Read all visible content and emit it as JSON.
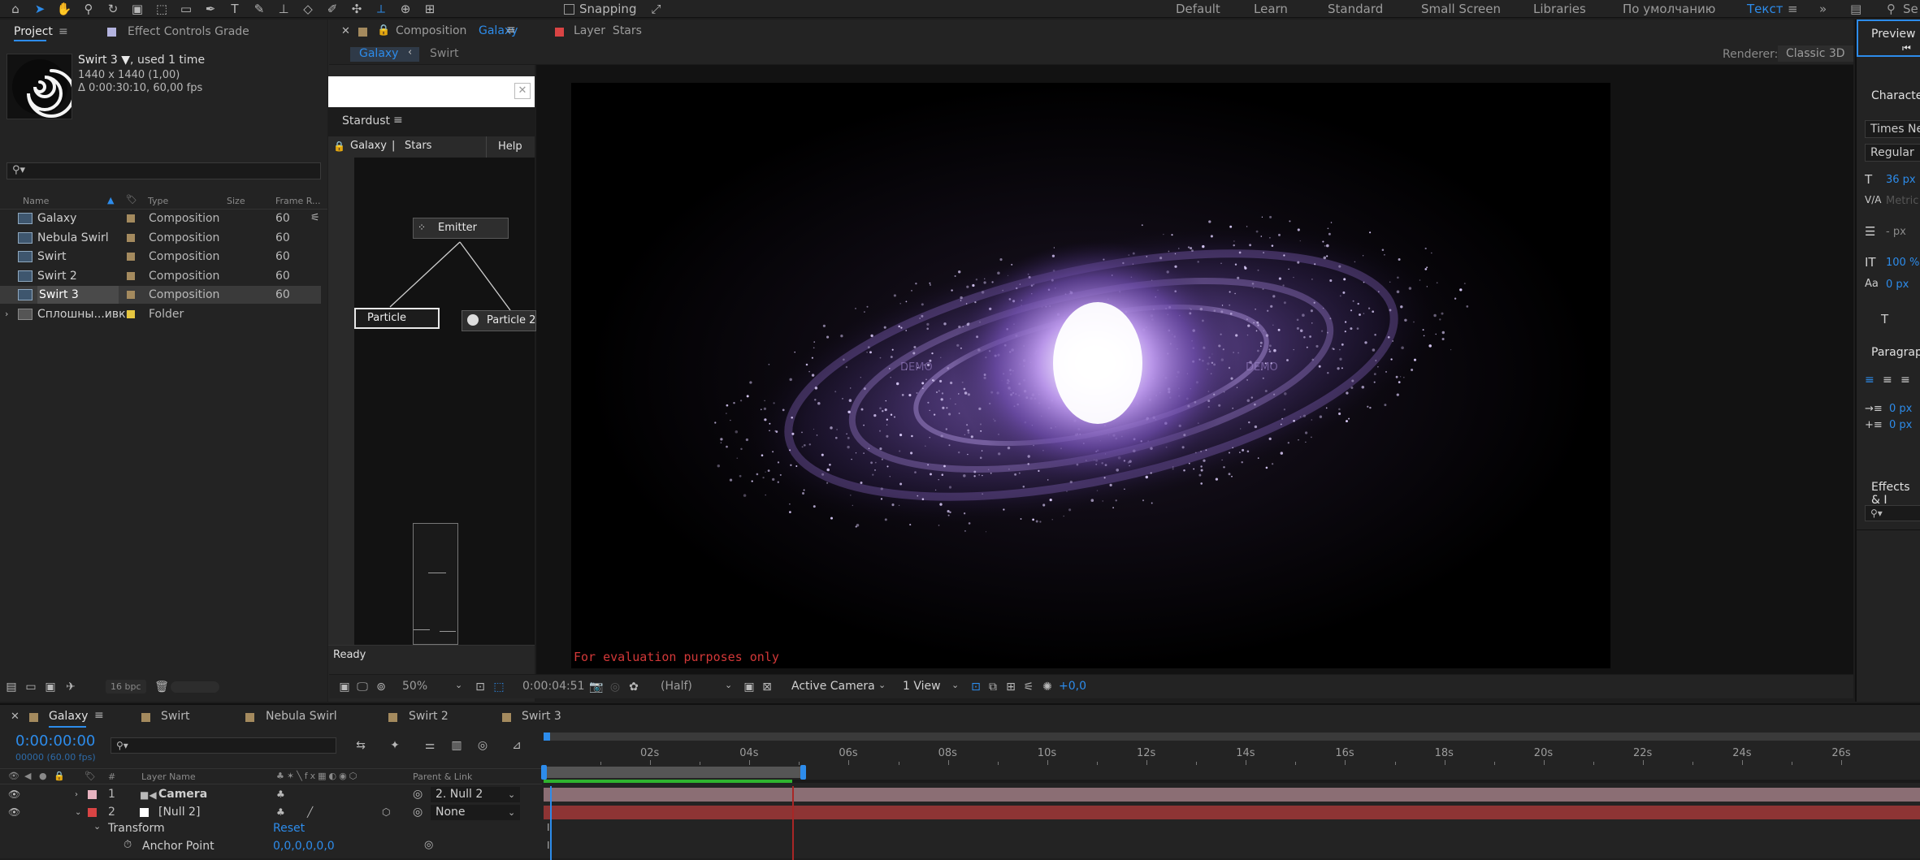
{
  "topbar": {
    "workspaces": [
      "Default",
      "Learn",
      "Standard",
      "Small Screen",
      "Libraries",
      "По умолчанию",
      "Текст"
    ],
    "snapping_label": "Snapping",
    "search_placeholder": "Se"
  },
  "project_panel": {
    "tab_project": "Project",
    "tab_effect_controls": "Effect Controls Grade",
    "selected_name": "Swirt 3 ▼",
    "used_times": ", used 1 time",
    "dimensions": "1440 x 1440 (1,00)",
    "duration": "Δ 0:00:30:10, 60,00 fps",
    "search_placeholder": "",
    "columns": {
      "name": "Name",
      "type": "Type",
      "size": "Size",
      "frame_rate": "Frame R..."
    },
    "items": [
      {
        "name": "Galaxy",
        "type": "Composition",
        "fps": "60",
        "color": "#a48a5e"
      },
      {
        "name": "Nebula Swirl",
        "type": "Composition",
        "fps": "60",
        "color": "#a48a5e"
      },
      {
        "name": "Swirt",
        "type": "Composition",
        "fps": "60",
        "color": "#a48a5e"
      },
      {
        "name": "Swirt 2",
        "type": "Composition",
        "fps": "60",
        "color": "#a48a5e"
      },
      {
        "name": "Swirt 3",
        "type": "Composition",
        "fps": "60",
        "color": "#a48a5e"
      },
      {
        "name": "Сплошны...ивки",
        "type": "Folder",
        "fps": "",
        "color": "#e6c640"
      }
    ],
    "bpc": "16 bpc"
  },
  "composition": {
    "tab_label": "Composition",
    "tab_name": "Galaxy",
    "layer_tab": "Layer  Stars",
    "breadcrumb_active": "Galaxy",
    "breadcrumb_next": "Swirt",
    "renderer_label": "Renderer:",
    "renderer_value": "Classic 3D",
    "watermark": "For evaluation purposes only",
    "demo_left": "DEMO",
    "demo_right": "DEMO",
    "zoom": "50%",
    "timecode": "0:00:04:51",
    "resolution": "(Half)",
    "camera": "Active Camera",
    "view": "1 View",
    "exposure": "+0,0"
  },
  "stardust": {
    "title": "Stardust",
    "breadcrumb_comp": "Galaxy",
    "breadcrumb_sep": "|",
    "breadcrumb_layer": "Stars",
    "help": "Help",
    "node_emitter": "Emitter",
    "node_particle": "Particle",
    "node_particle2": "Particle 2",
    "status": "Ready"
  },
  "right_panel": {
    "preview": "Preview",
    "character": "Character",
    "font": "Times New",
    "style": "Regular",
    "size": "36 px",
    "kerning": "Metric",
    "leading": "- px",
    "vscale": "100 %",
    "baseline": "0 px",
    "paragraph": "Paragraph",
    "indent1": "0 px",
    "indent2": "0 px",
    "effects": "Effects & I"
  },
  "timeline": {
    "tabs": [
      "Galaxy",
      "Swirt",
      "Nebula Swirl",
      "Swirt 2",
      "Swirt 3"
    ],
    "current_time": "0:00:00:00",
    "frame_info": "00000 (60.00 fps)",
    "col_num": "#",
    "col_layer_name": "Layer Name",
    "col_parent": "Parent & Link",
    "layers": [
      {
        "num": "1",
        "name": "Camera",
        "parent": "2. Null 2",
        "color": "#e7b3c0"
      },
      {
        "num": "2",
        "name": "[Null 2]",
        "parent": "None",
        "color": "#d94444"
      }
    ],
    "transform_label": "Transform",
    "reset_label": "Reset",
    "anchor_label": "Anchor Point",
    "anchor_value": "0,0,0,0,0,0",
    "ruler": [
      "02s",
      "04s",
      "06s",
      "08s",
      "10s",
      "12s",
      "14s",
      "16s",
      "18s",
      "20s",
      "22s",
      "24s",
      "26s"
    ]
  }
}
